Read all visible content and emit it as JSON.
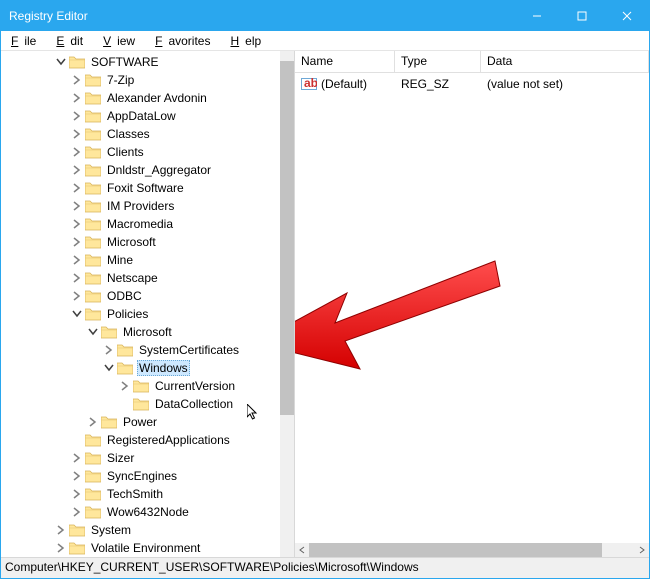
{
  "window": {
    "title": "Registry Editor"
  },
  "menu": {
    "file": "File",
    "edit": "Edit",
    "view": "View",
    "favorites": "Favorites",
    "help": "Help"
  },
  "columns": {
    "name": "Name",
    "type": "Type",
    "data": "Data"
  },
  "values": [
    {
      "name": "(Default)",
      "type": "REG_SZ",
      "data": "(value not set)"
    }
  ],
  "tree": {
    "root": "SOFTWARE",
    "selected": "Windows",
    "items": [
      "7-Zip",
      "Alexander Avdonin",
      "AppDataLow",
      "Classes",
      "Clients",
      "Dnldstr_Aggregator",
      "Foxit Software",
      "IM Providers",
      "Macromedia",
      "Microsoft",
      "Mine",
      "Netscape",
      "ODBC"
    ],
    "policies": {
      "label": "Policies",
      "microsoft": {
        "label": "Microsoft",
        "children": [
          "SystemCertificates"
        ],
        "windows": {
          "label": "Windows",
          "children": [
            "CurrentVersion",
            "DataCollection"
          ]
        }
      },
      "power": "Power"
    },
    "tail": [
      "RegisteredApplications",
      "Sizer",
      "SyncEngines",
      "TechSmith",
      "Wow6432Node"
    ],
    "after_software": [
      "System",
      "Volatile Environment"
    ]
  },
  "status": "Computer\\HKEY_CURRENT_USER\\SOFTWARE\\Policies\\Microsoft\\Windows"
}
